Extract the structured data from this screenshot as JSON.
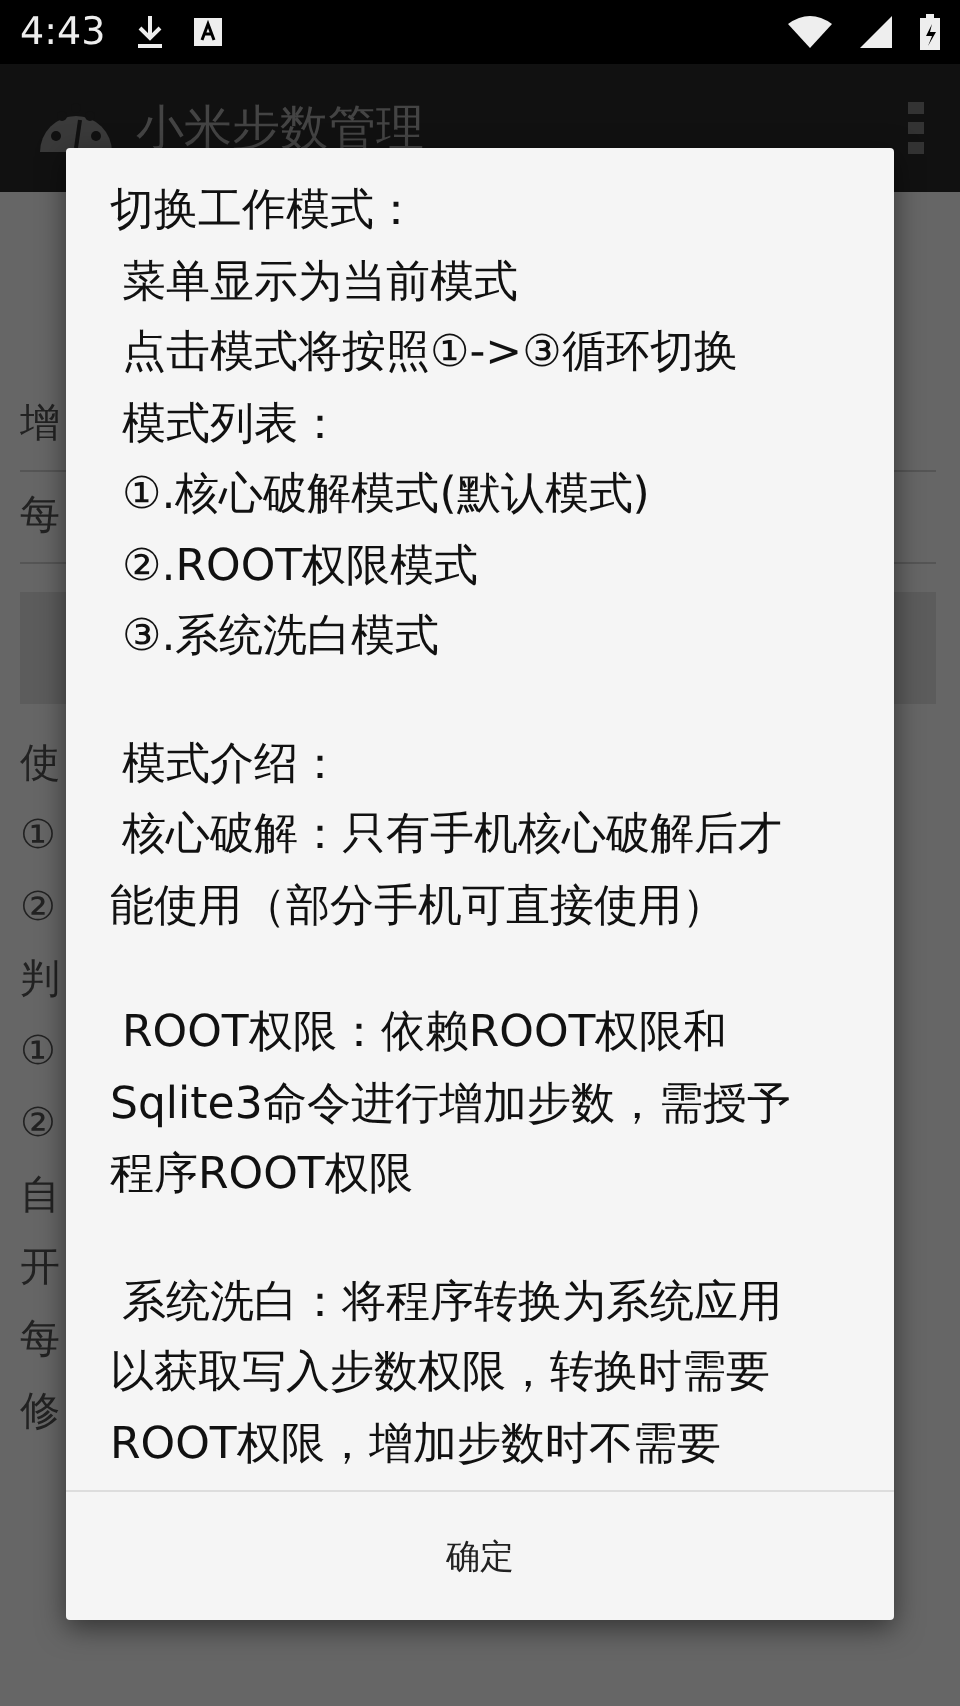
{
  "status_bar": {
    "time": "4:43"
  },
  "app_bar": {
    "title": "小米步数管理"
  },
  "background": [
    {
      "kind": "field",
      "text": "增"
    },
    {
      "kind": "field",
      "text": "每"
    },
    {
      "kind": "button"
    },
    {
      "kind": "text",
      "text": "使"
    },
    {
      "kind": "text",
      "text": "①"
    },
    {
      "kind": "text",
      "text": "②"
    },
    {
      "kind": "text",
      "text": "判"
    },
    {
      "kind": "text",
      "text": "①"
    },
    {
      "kind": "text",
      "text": "②"
    },
    {
      "kind": "text",
      "text": "自"
    },
    {
      "kind": "text",
      "text": "开"
    },
    {
      "kind": "text",
      "text": "每"
    },
    {
      "kind": "text",
      "text": "修"
    }
  ],
  "dialog": {
    "paragraphs": [
      {
        "lines": [
          {
            "text": "切换工作模式：",
            "indent": false
          },
          {
            "text": "菜单显示为当前模式",
            "indent": true
          },
          {
            "text": "点击模式将按照①->③循环切换",
            "indent": true
          },
          {
            "text": "模式列表：",
            "indent": true
          },
          {
            "text": "①.核心破解模式(默认模式)",
            "indent": true
          },
          {
            "text": "②.ROOT权限模式",
            "indent": true
          },
          {
            "text": "③.系统洗白模式",
            "indent": true
          }
        ]
      },
      {
        "lines": [
          {
            "text": "模式介绍：",
            "indent": true
          },
          {
            "text": "核心破解：只有手机核心破解后才",
            "indent": true
          },
          {
            "text": "能使用（部分手机可直接使用）",
            "indent": false
          }
        ]
      },
      {
        "lines": [
          {
            "text": "ROOT权限：依赖ROOT权限和",
            "indent": true
          },
          {
            "text": "Sqlite3命令进行增加步数，需授予",
            "indent": false
          },
          {
            "text": "程序ROOT权限",
            "indent": false
          }
        ]
      },
      {
        "lines": [
          {
            "text": "系统洗白：将程序转换为系统应用",
            "indent": true
          },
          {
            "text": "以获取写入步数权限，转换时需要",
            "indent": false
          },
          {
            "text": "ROOT权限，增加步数时不需要",
            "indent": false
          }
        ]
      }
    ],
    "button": "确定"
  }
}
